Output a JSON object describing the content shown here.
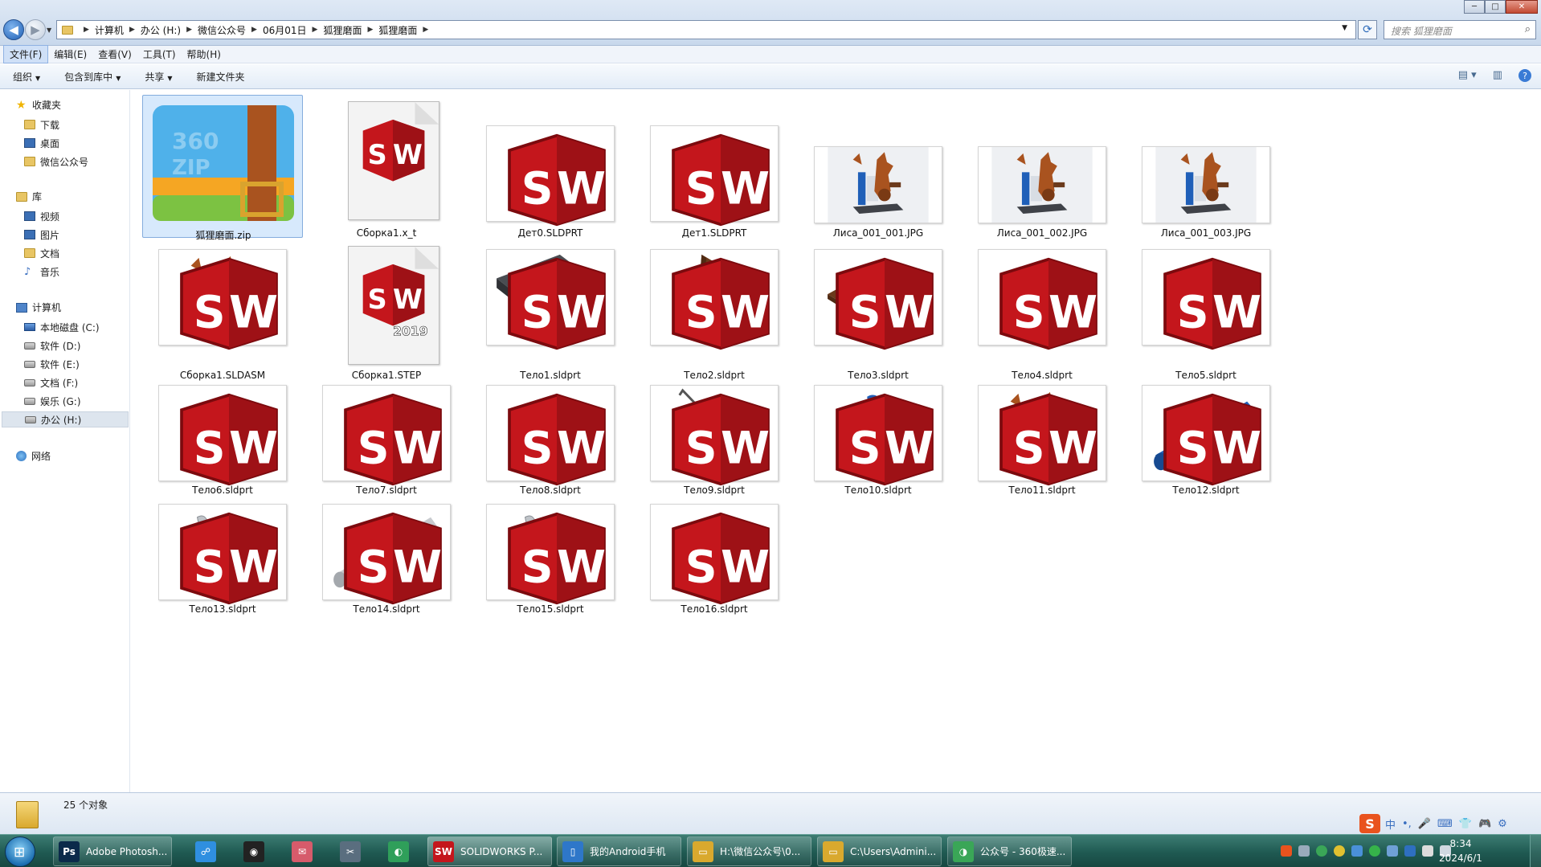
{
  "window": {
    "breadcrumbs": [
      "计算机",
      "办公 (H:)",
      "微信公众号",
      "06月01日",
      "狐狸磨面",
      "狐狸磨面"
    ],
    "search_placeholder": "搜索 狐狸磨面",
    "controls": [
      "─",
      "□",
      "✕"
    ]
  },
  "menu": [
    "文件(F)",
    "编辑(E)",
    "查看(V)",
    "工具(T)",
    "帮助(H)"
  ],
  "toolbar": {
    "organize": "组织",
    "include_library": "包含到库中",
    "share": "共享",
    "new_folder": "新建文件夹"
  },
  "sidebar": {
    "favorites": "收藏夹",
    "favorites_items": [
      "下载",
      "桌面",
      "微信公众号"
    ],
    "libraries": "库",
    "library_items": [
      "视频",
      "图片",
      "文档",
      "音乐"
    ],
    "computer": "计算机",
    "drives": [
      "本地磁盘 (C:)",
      "软件 (D:)",
      "软件 (E:)",
      "文档 (F:)",
      "娱乐 (G:)",
      "办公 (H:)"
    ],
    "network": "网络"
  },
  "files": [
    {
      "name": "狐狸磨面.zip",
      "kind": "zip-icon"
    },
    {
      "name": "Сборка1.x_t",
      "kind": "sw-doc-icon"
    },
    {
      "name": "Дет0.SLDPRT",
      "kind": "blank-thumb"
    },
    {
      "name": "Дет1.SLDPRT",
      "kind": "blank-thumb"
    },
    {
      "name": "Лиса_001_001.JPG",
      "kind": "fox-render"
    },
    {
      "name": "Лиса_001_002.JPG",
      "kind": "fox-render"
    },
    {
      "name": "Лиса_001_003.JPG",
      "kind": "fox-render"
    },
    {
      "name": "Сборка1.SLDASM",
      "kind": "fox-assembly"
    },
    {
      "name": "Сборка1.STEP",
      "kind": "sw-doc-icon-2019",
      "badge": "2019"
    },
    {
      "name": "Тело1.sldprt",
      "kind": "dark-plate"
    },
    {
      "name": "Тело2.sldprt",
      "kind": "brown-wedge"
    },
    {
      "name": "Тело3.sldprt",
      "kind": "orange-tray"
    },
    {
      "name": "Тело4.sldprt",
      "kind": "pulley"
    },
    {
      "name": "Тело5.sldprt",
      "kind": "pulley"
    },
    {
      "name": "Тело6.sldprt",
      "kind": "crank"
    },
    {
      "name": "Тело7.sldprt",
      "kind": "brown-disc"
    },
    {
      "name": "Тело8.sldprt",
      "kind": "tan-disc"
    },
    {
      "name": "Тело9.sldprt",
      "kind": "ring-rod"
    },
    {
      "name": "Тело10.sldprt",
      "kind": "blue-leg"
    },
    {
      "name": "Тело11.sldprt",
      "kind": "fox-body"
    },
    {
      "name": "Тело12.sldprt",
      "kind": "blue-cylinder"
    },
    {
      "name": "Тело13.sldprt",
      "kind": "arm"
    },
    {
      "name": "Тело14.sldprt",
      "kind": "grey-rod"
    },
    {
      "name": "Тело15.sldprt",
      "kind": "arm"
    },
    {
      "name": "Тело16.sldprt",
      "kind": "brown-roller"
    }
  ],
  "status": {
    "count": "25 个对象"
  },
  "taskbar": {
    "buttons": [
      {
        "label": "Adobe Photosh...",
        "icon": "photoshop-icon",
        "color": "#0b2a4a",
        "glyph": "Ps"
      },
      {
        "label": "",
        "icon": "network-app-icon",
        "color": "#2f8fe0",
        "glyph": "☍"
      },
      {
        "label": "",
        "icon": "obs-icon",
        "color": "#222222",
        "glyph": "◉"
      },
      {
        "label": "",
        "icon": "mail-app-icon",
        "color": "#d65b6b",
        "glyph": "✉"
      },
      {
        "label": "",
        "icon": "tool-app-icon",
        "color": "#5a6e7f",
        "glyph": "✂"
      },
      {
        "label": "",
        "icon": "browser-icon",
        "color": "#2f9f5a",
        "glyph": "◐"
      },
      {
        "label": "SOLIDWORKS P...",
        "icon": "solidworks-icon",
        "color": "#c4161c",
        "glyph": "SW"
      },
      {
        "label": "我的Android手机",
        "icon": "phone-icon",
        "color": "#2e77c9",
        "glyph": "▯"
      },
      {
        "label": "H:\\微信公众号\\0...",
        "icon": "folder-icon",
        "color": "#d9a92e",
        "glyph": "▭"
      },
      {
        "label": "C:\\Users\\Admini...",
        "icon": "folder-icon",
        "color": "#d9a92e",
        "glyph": "▭"
      },
      {
        "label": "公众号 - 360极速...",
        "icon": "360-browser-icon",
        "color": "#3aa657",
        "glyph": "◑"
      }
    ],
    "time": "8:34",
    "date": "2024/6/1"
  },
  "ime": {
    "logo": "S",
    "lang": "中",
    "items": [
      "•,",
      "🎤",
      "⌨",
      "👕",
      "🎮",
      "⚙"
    ]
  },
  "colors": {
    "accent": "#3a7bd5",
    "solidworks_red": "#c4161c",
    "taskbar": "#1f5a52"
  }
}
